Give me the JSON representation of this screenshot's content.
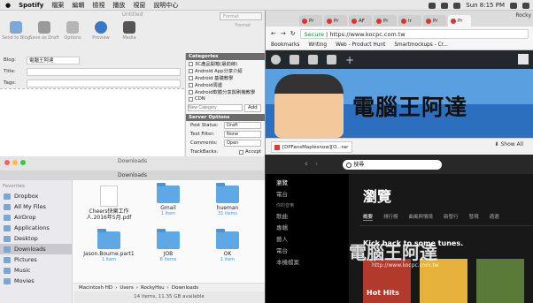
{
  "menubar": {
    "app": "Spotify",
    "items": [
      "檔案",
      "編輯",
      "檢視",
      "播放",
      "視窗",
      "說明中心"
    ],
    "time": "Sun 8:15 PM"
  },
  "editor": {
    "window_title": "Untitled",
    "toolbar": [
      "Send to Blog",
      "Save as Draft",
      "Options",
      "Preview",
      "Media"
    ],
    "format_select": "Format",
    "format_label": "Format",
    "blog_label": "Blog:",
    "blog_value": "電腦王阿達",
    "title_label": "Title:",
    "tags_label": "Tags:",
    "categories_header": "Categories",
    "categories": [
      "3C產品開箱(最前線)",
      "Android App分享介紹",
      "Android 基礎教學",
      "Android周邊",
      "Android軟體分享與刷機教學",
      "CDN"
    ],
    "new_category_placeholder": "New Category",
    "add_label": "Add",
    "server_header": "Server Options",
    "server": [
      {
        "label": "Post Status:",
        "value": "Draft"
      },
      {
        "label": "Text Filter:",
        "value": "None"
      },
      {
        "label": "Comments:",
        "value": "Open"
      },
      {
        "label": "TrackBacks:",
        "value": "Accept"
      }
    ]
  },
  "finder": {
    "window_title": "Downloads",
    "tab_title": "Downloads",
    "favorites_label": "Favorites",
    "sidebar": [
      "Dropbox",
      "All My Files",
      "AirDrop",
      "Applications",
      "Desktop",
      "Downloads",
      "Pictures",
      "Music",
      "Movies"
    ],
    "active": "Downloads",
    "files": [
      {
        "name": "Cheers快樂工作人.2016年5月.pdf",
        "sub": ""
      },
      {
        "name": "Gmail",
        "sub": "1 item"
      },
      {
        "name": "hueman",
        "sub": "31 items"
      },
      {
        "name": "Jason.Bourne.part1",
        "sub": "1 item"
      },
      {
        "name": "JOB",
        "sub": "8 items"
      },
      {
        "name": "OK",
        "sub": "1 item"
      }
    ],
    "path": [
      "Macintosh HD",
      "Users",
      "RockyHsu",
      "Downloads"
    ],
    "status": "14 items, 11.35 GB available"
  },
  "chrome": {
    "tabs": [
      "Pr",
      "Pr",
      "AF",
      "Pr",
      "Ir",
      "Pr",
      "Pr"
    ],
    "user": "Rocky",
    "url_secure": "Secure",
    "url": "https://www.kocpc.com.tw",
    "bookmarks": [
      "Bookmarks",
      "Writing",
      "Web - Product Hunt",
      "Smartmockups - Cr..."
    ],
    "hero_title": "電腦王阿達",
    "download_name": "[DPFansMaplesnow][O...rar",
    "show_all": "Show All"
  },
  "spotify": {
    "search_placeholder": "搜尋",
    "nav": [
      "瀏覽",
      "電台"
    ],
    "your_music": "你的音樂",
    "nav2": [
      "歌曲",
      "專輯",
      "藝人",
      "電台",
      "本機檔案"
    ],
    "heading": "瀏覽",
    "tabs": [
      "概要",
      "排行榜",
      "曲風與情境",
      "新發行",
      "發現",
      "適選"
    ],
    "kick": "Kick back to some tunes.",
    "card_label": "Hot Hits",
    "watermark": "電腦王阿達",
    "watermark_url": "http://www.kocpc.com.tw"
  },
  "colors": {
    "spotify_green": "#1db954",
    "wp_dark": "#23282d",
    "secure_green": "#0a8a30"
  }
}
